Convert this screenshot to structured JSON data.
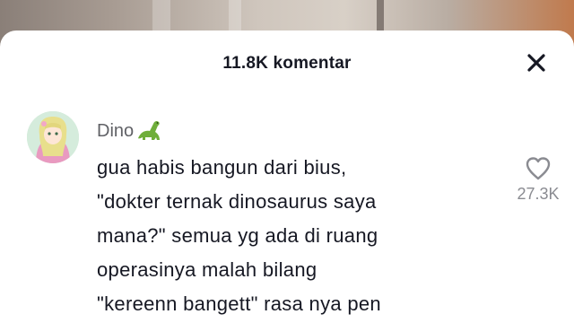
{
  "header": {
    "title": "11.8K komentar"
  },
  "icons": {
    "close": "close-icon",
    "like": "heart-icon",
    "emoji": "sauropod-dinosaur-emoji"
  },
  "comment": {
    "username": "Dino",
    "text_lines": [
      "gua habis bangun dari bius,",
      "\"dokter ternak dinosaurus saya",
      "mana?\" semua yg ada di ruang",
      "operasinya malah bilang",
      "\"kereenn bangett\" rasa nya pen"
    ],
    "like_count": "27.3K"
  },
  "colors": {
    "text_primary": "#161823",
    "text_secondary": "#606166",
    "count": "#8a8b91",
    "dino_green": "#6fae3a"
  }
}
